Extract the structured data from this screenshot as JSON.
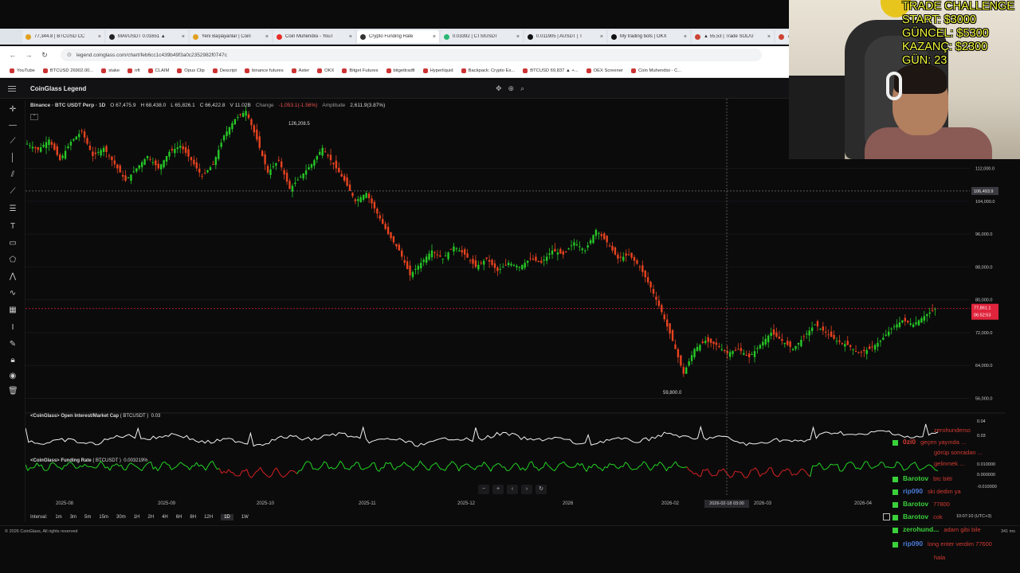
{
  "browser": {
    "tabs": [
      {
        "label": "77,344.8 | BTCUSD CC",
        "icon": "coin-icon"
      },
      {
        "label": "MAVUSDT 0.01651 ▲",
        "icon": "tradingview-icon"
      },
      {
        "label": "Yeni Başlayanlar | Coin",
        "icon": "coin-icon"
      },
      {
        "label": "Coin Muhendisi - YouT",
        "icon": "youtube-icon"
      },
      {
        "label": "Crypto Funding Rate",
        "icon": "coinglass-icon"
      },
      {
        "label": "0.03392 | CTSIUSDT",
        "icon": "exchange-icon"
      },
      {
        "label": "0.011905 | AUSDT | T",
        "icon": "okx-icon"
      },
      {
        "label": "My trading bots | OKX",
        "icon": "okx-icon"
      },
      {
        "label": "▲ 55,53 | Trade SOL/U",
        "icon": "trade-icon"
      },
      {
        "label": "77.84",
        "icon": "trade-icon"
      }
    ],
    "url": "legend.coinglass.com/chart/feb6cc1c439b49f3a0c2352982f0747c",
    "bookmarks": [
      "YouTube",
      "BTCUSD 26902.00...",
      "stake",
      "nft",
      "CLAIM",
      "Opus Clip",
      "Descript",
      "binance futures",
      "Aster",
      "OKX",
      "Bitget Futures",
      "bitgettradfi",
      "Hyperliquid",
      "Backpack: Crypto Ex...",
      "BTCUSD 69,837 ▲ +...",
      "OEX Screener",
      "Coin Muhendisi - C..."
    ]
  },
  "app": {
    "title": "CoinGlass Legend"
  },
  "symbol_bar": {
    "symbol": "Binance · BTC USDT Perp · 1D",
    "open": "O 67,475.9",
    "high": "H 68,438.0",
    "low": "L 65,826.1",
    "close": "C 66,422.8",
    "volume": "V 11.02B",
    "change_label": "Change",
    "change": "-1,053.1(-1.56%)",
    "amplitude_label": "Amplitude",
    "amplitude": "2,611.9(3.87%)"
  },
  "chart_data": {
    "type": "candlestick",
    "title": "Binance · BTC USDT Perp · 1D",
    "y_axis_ticks": [
      "112,000.0",
      "104,000.0",
      "96,000.0",
      "88,000.0",
      "80,000.0",
      "72,000.0",
      "64,000.0",
      "56,000.0"
    ],
    "ylim": [
      53000,
      128000
    ],
    "x_axis_ticks": [
      "2025-08",
      "2025-09",
      "2025-10",
      "2025-11",
      "2025-12",
      "2026",
      "2026-02",
      "2026-03",
      "2026-04"
    ],
    "annotations": {
      "high": "126,208.5",
      "low": "59,800.0"
    },
    "crosshair_price": "106,493.9",
    "crosshair_time": "2026-02-18 03:00",
    "last_price": "77,861.1",
    "countdown": "06:52:53",
    "close_path": [
      [
        0,
        118000
      ],
      [
        4,
        116500
      ],
      [
        8,
        119000
      ],
      [
        12,
        114000
      ],
      [
        16,
        118500
      ],
      [
        20,
        121000
      ],
      [
        24,
        115000
      ],
      [
        28,
        117000
      ],
      [
        32,
        113000
      ],
      [
        36,
        109000
      ],
      [
        40,
        112000
      ],
      [
        44,
        115000
      ],
      [
        48,
        112000
      ],
      [
        52,
        116000
      ],
      [
        56,
        117500
      ],
      [
        60,
        114000
      ],
      [
        64,
        110000
      ],
      [
        68,
        113000
      ],
      [
        72,
        120000
      ],
      [
        76,
        124000
      ],
      [
        80,
        126000
      ],
      [
        84,
        119000
      ],
      [
        88,
        111000
      ],
      [
        92,
        114000
      ],
      [
        96,
        107000
      ],
      [
        100,
        110000
      ],
      [
        104,
        113000
      ],
      [
        108,
        117000
      ],
      [
        112,
        113000
      ],
      [
        116,
        109000
      ],
      [
        120,
        104000
      ],
      [
        124,
        106000
      ],
      [
        128,
        101000
      ],
      [
        132,
        96000
      ],
      [
        136,
        92000
      ],
      [
        140,
        86000
      ],
      [
        144,
        89000
      ],
      [
        148,
        92000
      ],
      [
        152,
        90000
      ],
      [
        156,
        93000
      ],
      [
        160,
        91000
      ],
      [
        164,
        88000
      ],
      [
        168,
        90000
      ],
      [
        172,
        87000
      ],
      [
        176,
        89000
      ],
      [
        180,
        88000
      ],
      [
        184,
        90000
      ],
      [
        188,
        89000
      ],
      [
        192,
        92000
      ],
      [
        196,
        91000
      ],
      [
        200,
        94000
      ],
      [
        204,
        92000
      ],
      [
        208,
        97000
      ],
      [
        212,
        94000
      ],
      [
        216,
        90000
      ],
      [
        220,
        91000
      ],
      [
        224,
        88000
      ],
      [
        228,
        83000
      ],
      [
        232,
        77000
      ],
      [
        236,
        70000
      ],
      [
        240,
        62000
      ],
      [
        244,
        68000
      ],
      [
        248,
        70000
      ],
      [
        252,
        69000
      ],
      [
        256,
        67000
      ],
      [
        260,
        68000
      ],
      [
        264,
        66000
      ],
      [
        268,
        69000
      ],
      [
        272,
        72000
      ],
      [
        276,
        70000
      ],
      [
        280,
        68000
      ],
      [
        284,
        71000
      ],
      [
        288,
        74000
      ],
      [
        292,
        72000
      ],
      [
        296,
        70000
      ],
      [
        300,
        69000
      ],
      [
        304,
        67000
      ],
      [
        308,
        68000
      ],
      [
        312,
        70000
      ],
      [
        316,
        73000
      ],
      [
        320,
        75000
      ],
      [
        324,
        74000
      ],
      [
        328,
        76000
      ],
      [
        332,
        77800
      ]
    ],
    "indicators": [
      {
        "name": "<CoinGlass> Open Interest/Market Cap",
        "symbol": "BTCUSDT",
        "value": "0.03",
        "ticks": [
          "0.04",
          "0.03"
        ]
      },
      {
        "name": "<CoinGlass> Funding Rate",
        "symbol": "BTCUSDT",
        "value": "0.003219%",
        "ticks": [
          "0.010000",
          "0.000000",
          "-0.010000"
        ]
      }
    ]
  },
  "intervals": {
    "label": "Interval:",
    "items": [
      "1m",
      "3m",
      "5m",
      "15m",
      "30m",
      "1H",
      "2H",
      "4H",
      "6H",
      "8H",
      "12H",
      "1D",
      "1W"
    ],
    "active": "1D"
  },
  "footer": {
    "copyright": "© 2026 CoinGlass, All rights reserved",
    "latency": "341 ms",
    "timezone": "10:07:10 (UTC+3)"
  },
  "overlay": {
    "challenge": [
      "TRADE CHALLENGE",
      "START: $3000",
      "GÜNCEL: $5300",
      "KAZANÇ: $2300",
      "GÜN: 23"
    ],
    "chat": [
      {
        "user": "",
        "msg": "zerohunderso",
        "color": "#d43a2f"
      },
      {
        "user": "0zi0",
        "msg": "geçen yayında ...",
        "color": "#d43a2f"
      },
      {
        "user": "",
        "msg": "görüp sonradan ...",
        "color": "#d43a2f"
      },
      {
        "user": "",
        "msg": "gelinmek ...",
        "color": "#d43a2f"
      },
      {
        "user": "Barotov",
        "msg": "btc bitti",
        "color": "#3ad13a"
      },
      {
        "user": "rip090",
        "msg": "ski dedim ya",
        "color": "#4a7bd8"
      },
      {
        "user": "Barotov",
        "msg": "77800",
        "color": "#3ad13a"
      },
      {
        "user": "Barotov",
        "msg": "cok",
        "color": "#3ad13a"
      },
      {
        "user": "zerohund...",
        "msg": "adam gibi bile",
        "color": "#3ad13a"
      },
      {
        "user": "rip090",
        "msg": "long enter verdim 77600",
        "color": "#4a7bd8"
      },
      {
        "user": "",
        "msg": "hala",
        "color": "#d43a2f"
      }
    ]
  }
}
